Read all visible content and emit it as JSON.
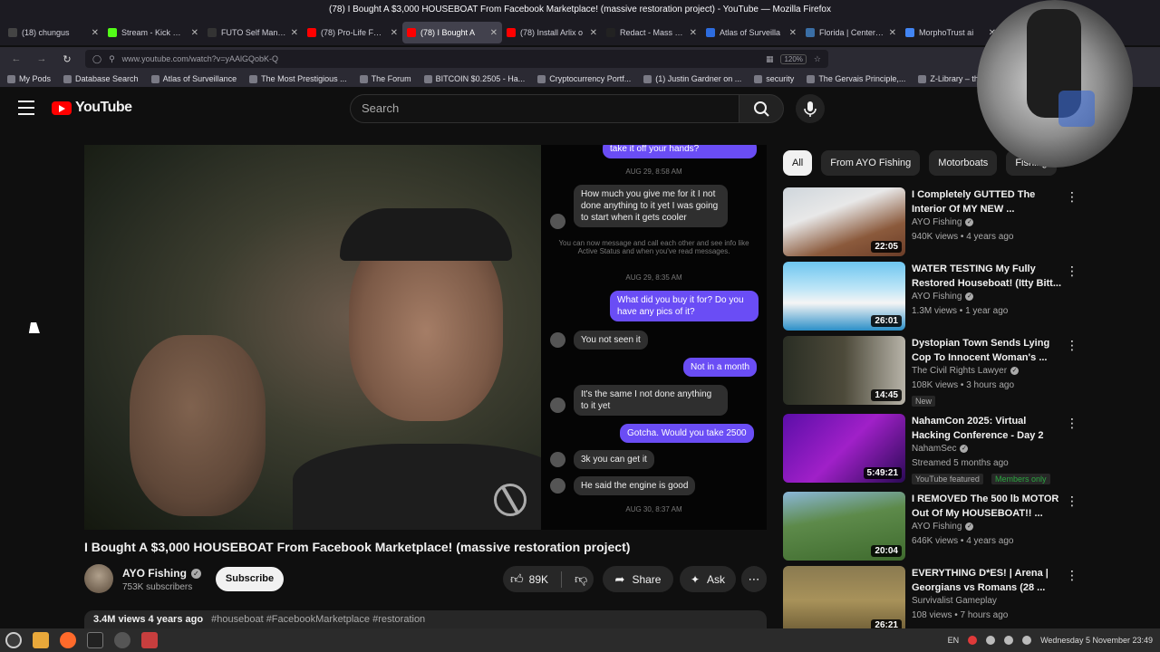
{
  "window": {
    "title": "(78) I Bought A $3,000 HOUSEBOAT From Facebook Marketplace! (massive restoration project) - YouTube — Mozilla Firefox"
  },
  "tabs": [
    {
      "label": "(18) chungus",
      "color": "#444444"
    },
    {
      "label": "Stream - Kick Dash",
      "color": "#53fc18"
    },
    {
      "label": "FUTO Self Managed C",
      "color": "#333333"
    },
    {
      "label": "(78) Pro-Life Femi",
      "color": "#ff0000"
    },
    {
      "label": "(78) I Bought A",
      "color": "#ff0000",
      "active": true
    },
    {
      "label": "(78) Install Arlix o",
      "color": "#ff0000"
    },
    {
      "label": "Redact - Mass Del",
      "color": "#222222"
    },
    {
      "label": "Atlas of Surveilla",
      "color": "#2d6cdf"
    },
    {
      "label": "Florida | Center or",
      "color": "#3a6ea5"
    },
    {
      "label": "MorphoTrust ai",
      "color": "#4285f4"
    }
  ],
  "navbar": {
    "url": "www.youtube.com/watch?v=yAAlGQobK-Q",
    "zoom": "120%"
  },
  "bookmarks": [
    "My Pods",
    "Database Search",
    "Atlas of Surveillance",
    "The Most Prestigious ...",
    "The Forum",
    "BITCOIN $0.2505 - Ha...",
    "Cryptocurrency Portf...",
    "(1) Justin Gardner on ...",
    "security",
    "The Gervais Principle,...",
    "Z-Library – the world'..."
  ],
  "masthead": {
    "logo_text": "YouTube",
    "search_placeholder": "Search"
  },
  "video": {
    "title": "I Bought A $3,000 HOUSEBOAT From Facebook Marketplace! (massive restoration project)",
    "chat": {
      "top_snippet": "take it off your hands?",
      "stamp1": "AUG 29, 8:58 AM",
      "msg1": "How much you give me for it I not done anything to it yet I was going to start when it gets cooler",
      "notice": "You can now message and call each other and see info like Active Status and when you've read messages.",
      "stamp2": "AUG 29, 8:35 AM",
      "msg2": "What did you buy it for? Do you have any pics of it?",
      "msg3": "You not seen it",
      "msg4": "Not in a month",
      "msg5": "It's the same I not done anything to it yet",
      "msg6": "Gotcha. Would you take 2500",
      "msg7": "3k you can get it",
      "msg8": "He said the engine is good",
      "stamp3": "AUG 30, 8:37 AM"
    }
  },
  "channel": {
    "name": "AYO Fishing",
    "subscribers": "753K subscribers",
    "subscribe_label": "Subscribe"
  },
  "actions": {
    "likes": "89K",
    "share": "Share",
    "ask": "Ask"
  },
  "description": {
    "stats": "3.4M views  4 years ago",
    "tags": "#houseboat #FacebookMarketplace #restoration"
  },
  "chips": [
    "All",
    "From AYO Fishing",
    "Motorboats",
    "Fishing"
  ],
  "recommendations": [
    {
      "title": "I Completely GUTTED The Interior Of MY NEW ...",
      "channel": "AYO Fishing",
      "verified": true,
      "meta": "940K views • 4 years ago",
      "duration": "22:05",
      "thumb": "linear-gradient(160deg,#cfd6dc 0%,#e8e8e8 35%,#8b5a3c 70%,#6b3d28 100%)"
    },
    {
      "title": "WATER TESTING My Fully Restored Houseboat! (Itty Bitt...",
      "channel": "AYO Fishing",
      "verified": true,
      "meta": "1.3M views • 1 year ago",
      "duration": "26:01",
      "thumb": "linear-gradient(180deg,#6ec6f0 0%,#bfe6f7 40%,#f5f5f5 60%,#2b8fc8 100%)"
    },
    {
      "title": "Dystopian Town Sends Lying Cop To Innocent Woman's ...",
      "channel": "The Civil Rights Lawyer",
      "verified": true,
      "meta": "108K views • 3 hours ago",
      "duration": "14:45",
      "badge": "New",
      "thumb": "linear-gradient(90deg,#2a2e24 0%,#4d4a3a 50%,#b7b3a8 100%)"
    },
    {
      "title": "NahamCon 2025: Virtual Hacking Conference - Day 2",
      "channel": "NahamSec",
      "verified": true,
      "meta": "Streamed 5 months ago",
      "duration": "5:49:21",
      "badge": "YouTube featured",
      "badge2": "Members only",
      "thumb": "linear-gradient(135deg,#5b0ea8 0%,#a020c8 50%,#2a0a55 100%)"
    },
    {
      "title": "I REMOVED The 500 lb MOTOR Out Of My HOUSEBOAT!! ...",
      "channel": "AYO Fishing",
      "verified": true,
      "meta": "646K views • 4 years ago",
      "duration": "20:04",
      "thumb": "linear-gradient(170deg,#8bb7d9 0%,#5d8a4a 40%,#3f6b2e 100%)"
    },
    {
      "title": "EVERYTHING D*ES! | Arena | Georgians vs Romans (28 ...",
      "channel": "Survivalist Gameplay",
      "verified": false,
      "meta": "108 views • 7 hours ago",
      "duration": "26:21",
      "thumb": "linear-gradient(180deg,#8a7a50 0%,#a8925a 50%,#6b5a34 100%)"
    }
  ],
  "taskbar": {
    "lang": "EN",
    "date": "Wednesday  5 November 23:49"
  }
}
